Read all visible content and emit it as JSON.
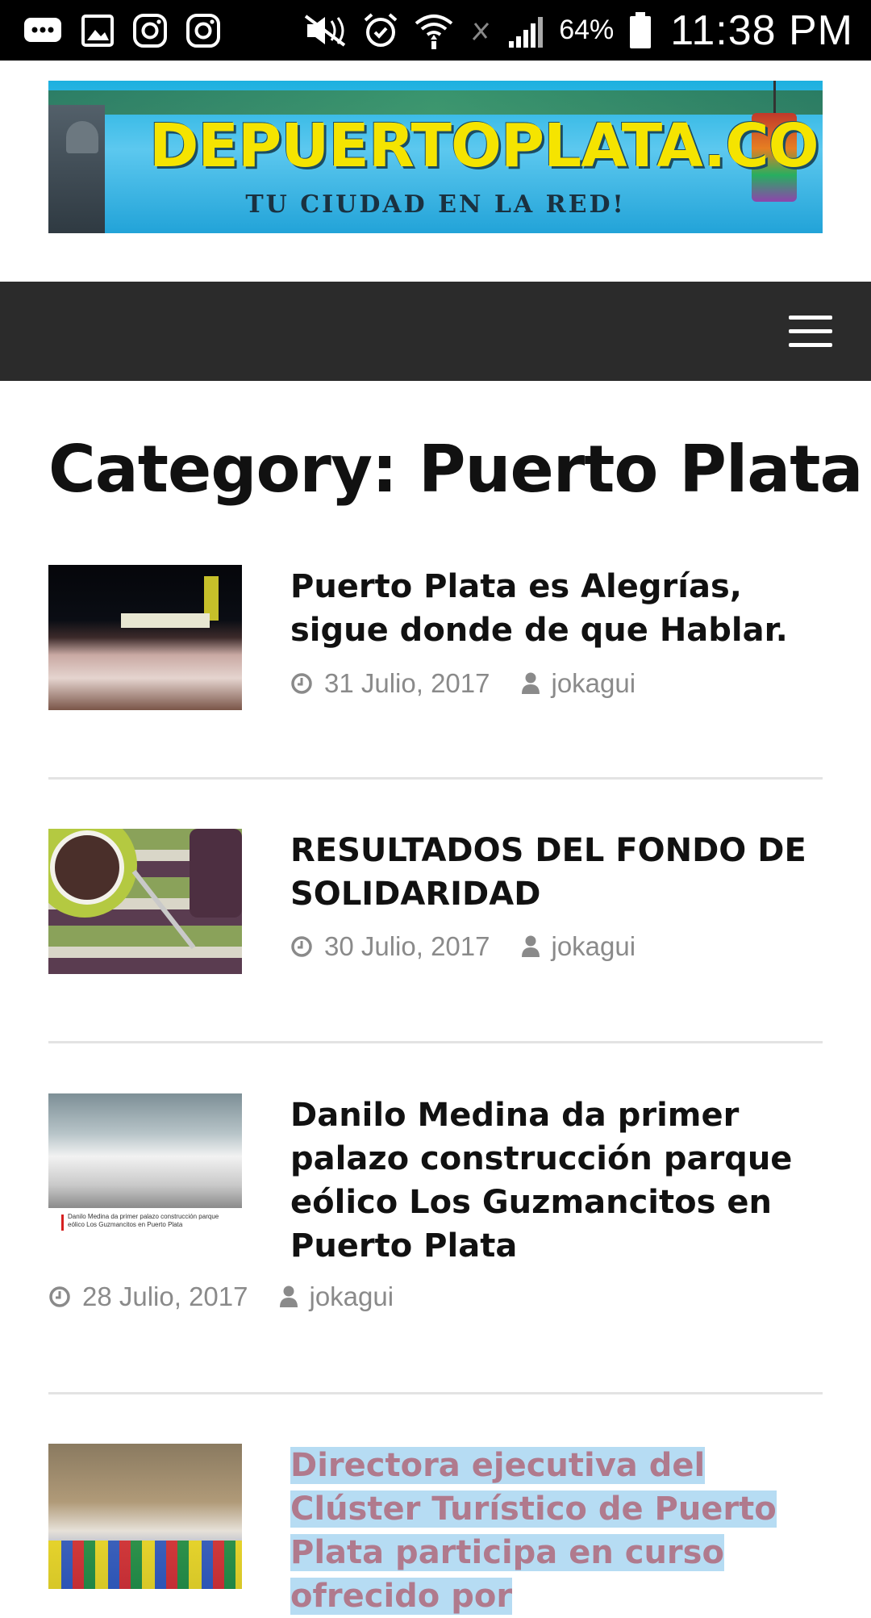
{
  "status_bar": {
    "battery_percent": "64%",
    "time": "11:38 PM",
    "left_icons": [
      "chat-icon",
      "gallery-icon",
      "instagram-icon",
      "instagram-icon"
    ],
    "right_icons": [
      "mute-icon",
      "alarm-icon",
      "wifi-icon",
      "no-signal-icon",
      "signal-icon",
      "battery-icon"
    ]
  },
  "banner": {
    "title": "DEPUERTOPLATA.COM",
    "subtitle": "TU CIUDAD EN LA RED!"
  },
  "nav": {
    "menu_icon": "hamburger-icon"
  },
  "page": {
    "title": "Category: Puerto Plata"
  },
  "posts": [
    {
      "title": "Puerto Plata es Alegrías, sigue donde de que Hablar.",
      "date": "31 Julio, 2017",
      "author": "jokagui"
    },
    {
      "title": "RESULTADOS DEL FONDO DE SOLIDARIDAD",
      "date": "30 Julio, 2017",
      "author": "jokagui"
    },
    {
      "title": "Danilo Medina da primer palazo construcción parque eólico Los Guzmancitos en Puerto Plata",
      "date": "28 Julio, 2017",
      "author": "jokagui",
      "thumb_caption": "Danilo Medina da primer palazo construcción parque eólico Los Guzmancitos en Puerto Plata"
    },
    {
      "title": "Directora ejecutiva del Clúster Turístico de Puerto Plata participa en curso ofrecido por"
    }
  ],
  "colors": {
    "nav_bg": "#2b2b2b",
    "meta_text": "#8a8a8a",
    "highlight": "#b6dcf3"
  }
}
